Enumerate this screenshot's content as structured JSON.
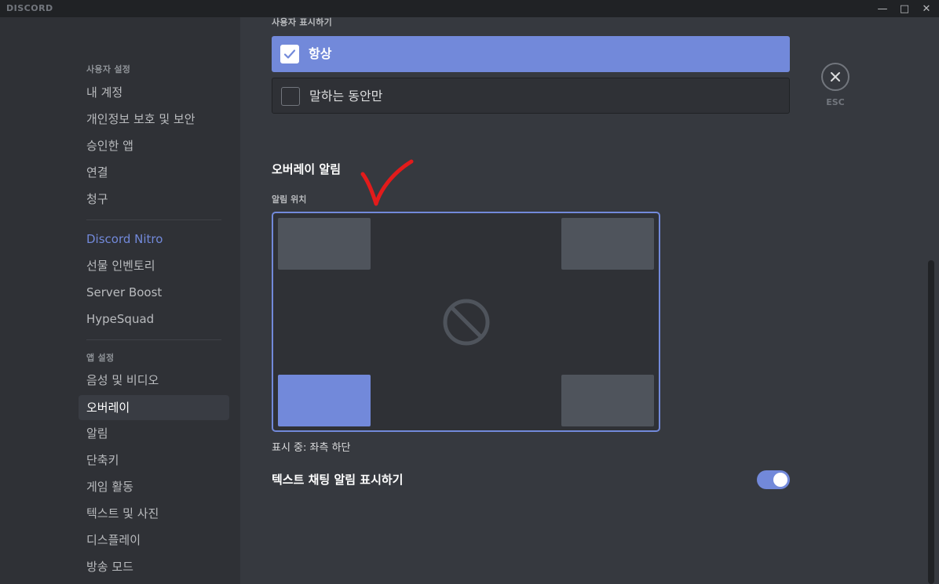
{
  "window": {
    "app_name": "DISCORD",
    "controls": [
      "minimize-icon",
      "maximize-icon",
      "close-icon"
    ]
  },
  "sidebar": {
    "user_settings_header": "사용자 설정",
    "user_items": [
      {
        "label": "내 계정"
      },
      {
        "label": "개인정보 보호 및 보안"
      },
      {
        "label": "승인한 앱"
      },
      {
        "label": "연결"
      },
      {
        "label": "청구"
      }
    ],
    "nitro_items": [
      {
        "label": "Discord Nitro"
      },
      {
        "label": "선물 인벤토리"
      },
      {
        "label": "Server Boost"
      },
      {
        "label": "HypeSquad"
      }
    ],
    "app_settings_header": "앱 설정",
    "app_items": [
      {
        "label": "음성 및 비디오"
      },
      {
        "label": "오버레이",
        "active": true
      },
      {
        "label": "알림"
      },
      {
        "label": "단축키"
      },
      {
        "label": "게임 활동"
      },
      {
        "label": "텍스트 및 사진"
      },
      {
        "label": "디스플레이"
      },
      {
        "label": "방송 모드"
      }
    ]
  },
  "content": {
    "show_users_label": "사용자 표시하기",
    "options": [
      {
        "label": "항상",
        "selected": true
      },
      {
        "label": "말하는 동안만",
        "selected": false
      }
    ],
    "esc_label": "ESC",
    "notifications_heading": "오버레이 알림",
    "position_label": "알림 위치",
    "positions": {
      "top_left": false,
      "top_right": false,
      "bottom_left": true,
      "bottom_right": false,
      "center_disable_icon": "disabled-circle-icon"
    },
    "status_text": "표시 중: 좌측 하단",
    "text_chat_toggle_label": "텍스트 채팅 알림 표시하기",
    "text_chat_toggle_on": true
  },
  "colors": {
    "accent": "#7289da",
    "annotation": "#e21b1b"
  }
}
